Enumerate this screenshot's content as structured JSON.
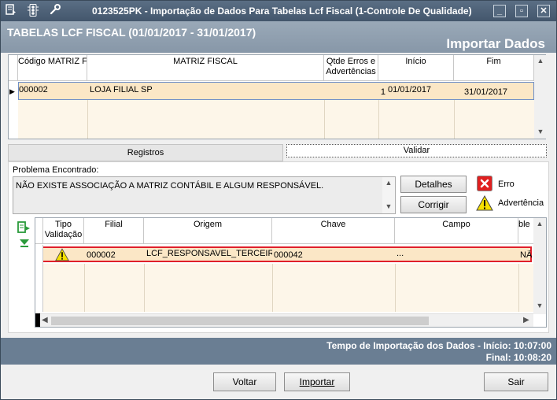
{
  "window": {
    "title": "0123525PK - Importação de Dados Para Tabelas Lcf Fiscal (1-Controle De Qualidade)",
    "icons": [
      "menu-icon",
      "traffic-light-icon",
      "wrench-icon"
    ],
    "controls": {
      "minimize": "_",
      "restore": "▫",
      "close": "✕"
    }
  },
  "header": {
    "title": "TABELAS LCF FISCAL (01/01/2017 - 31/01/2017)",
    "subtitle": "Importar Dados"
  },
  "top_grid": {
    "columns": [
      "Código MATRIZ FISCAL",
      "MATRIZ FISCAL",
      "Qtde Erros e Advertências",
      "Início",
      "Fim"
    ],
    "rows": [
      {
        "codigo": "000002",
        "matriz": "LOJA FILIAL SP",
        "qtde": "1",
        "inicio": "01/01/2017",
        "fim": "31/01/2017"
      }
    ],
    "row_color": "#fbe7c6"
  },
  "tabs": [
    {
      "label": "Registros",
      "active": false
    },
    {
      "label": "Validar",
      "active": true
    }
  ],
  "problem": {
    "label": "Problema Encontrado:",
    "text": "NÃO EXISTE ASSOCIAÇÃO A MATRIZ CONTÁBIL E ALGUM RESPONSÁVEL."
  },
  "buttons": {
    "detalhes": "Detalhes",
    "corrigir": "Corrigir",
    "voltar": "Voltar",
    "importar": "Importar",
    "sair": "Sair"
  },
  "legend": {
    "erro": "Erro",
    "advertencia": "Advertência",
    "erro_color": "#e02020",
    "adv_color": "#f6e000"
  },
  "bottom_grid": {
    "columns": [
      "Tipo Validação",
      "Filial",
      "Origem",
      "Chave",
      "Campo",
      "ble"
    ],
    "rows": [
      {
        "tipo_icon": "warning-icon",
        "filial": "000002",
        "origem": "LCF_RESPONSAVEL_TERCEIRO",
        "chave": "000042",
        "campo": "...",
        "extra": "NÃ"
      }
    ],
    "highlight_color": "#e0202b"
  },
  "status": {
    "line1": "Tempo de Importação dos Dados - Início: 10:07:00",
    "line2": "Final: 10:08:20"
  }
}
